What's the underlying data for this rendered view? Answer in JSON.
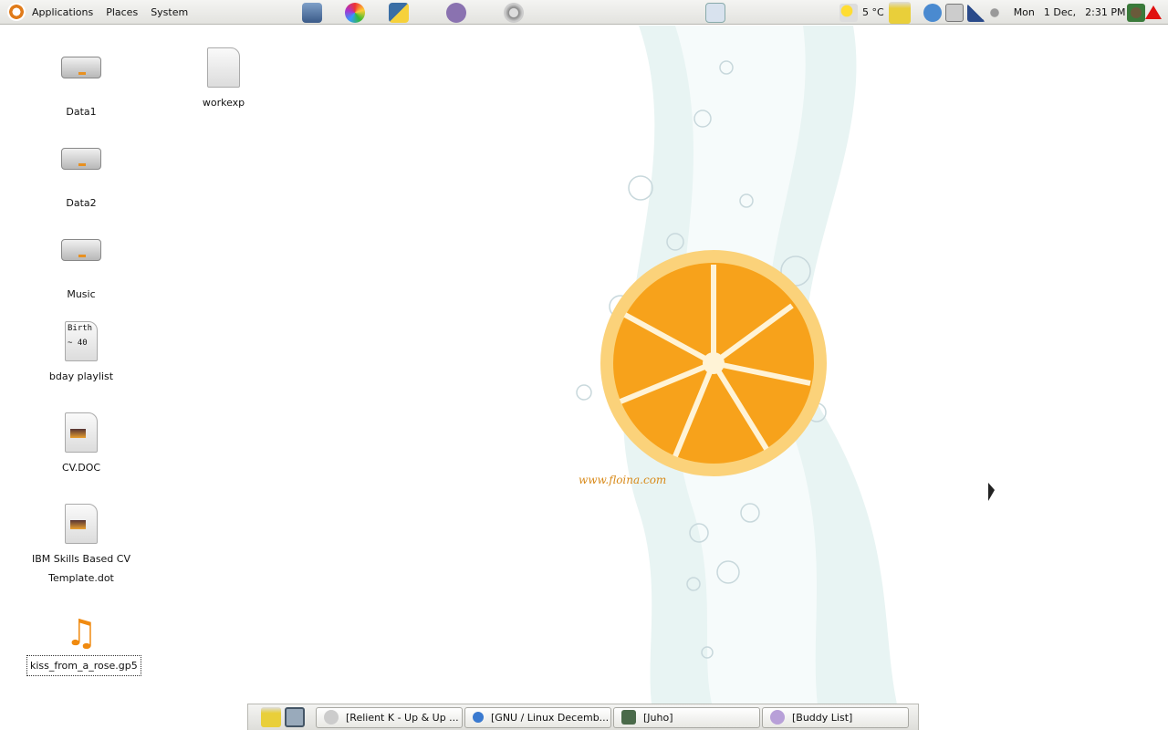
{
  "top_panel": {
    "menus": [
      "Applications",
      "Places",
      "System"
    ],
    "launchers": [
      "monitor-icon",
      "color-wheel-icon",
      "python-icon",
      "pidgin-icon",
      "audio-player-icon",
      "notes-icon"
    ],
    "weather": {
      "icon": "partly-cloudy-icon",
      "temperature": "5 °C"
    },
    "tray_icons": [
      "trash-icon",
      "clock-chat-icon",
      "speaker-device-icon",
      "signal-bars-icon",
      "volume-icon"
    ],
    "clock": {
      "day": "Mon",
      "date": "1 Dec,",
      "time": "2:31 PM"
    },
    "right_icons": [
      "users-icon",
      "alert-triangle-icon"
    ]
  },
  "desktop_icons": [
    {
      "label": "Data1",
      "type": "drive"
    },
    {
      "label": "Data2",
      "type": "drive"
    },
    {
      "label": "Music",
      "type": "drive"
    },
    {
      "label": "bday playlist",
      "type": "text",
      "preview": [
        "Birth",
        "~ 40"
      ]
    },
    {
      "label": "CV.DOC",
      "type": "document"
    },
    {
      "label": "IBM Skills Based CV Template.dot",
      "type": "document"
    },
    {
      "label": "kiss_from_a_rose.gp5",
      "type": "music",
      "selected": true
    },
    {
      "label": "workexp",
      "type": "blank"
    }
  ],
  "wallpaper": {
    "watermark": "www.floina.com",
    "accent": "#f6a21a"
  },
  "taskbar": {
    "items": [
      {
        "label": "[Relient K - Up & Up ...",
        "icon": "audio-player-icon"
      },
      {
        "label": "[GNU / Linux Decemb...",
        "icon": "browser-globe-icon"
      },
      {
        "label": "[Juho]",
        "icon": "chat-user-icon"
      },
      {
        "label": "[Buddy List]",
        "icon": "pidgin-icon"
      }
    ]
  }
}
